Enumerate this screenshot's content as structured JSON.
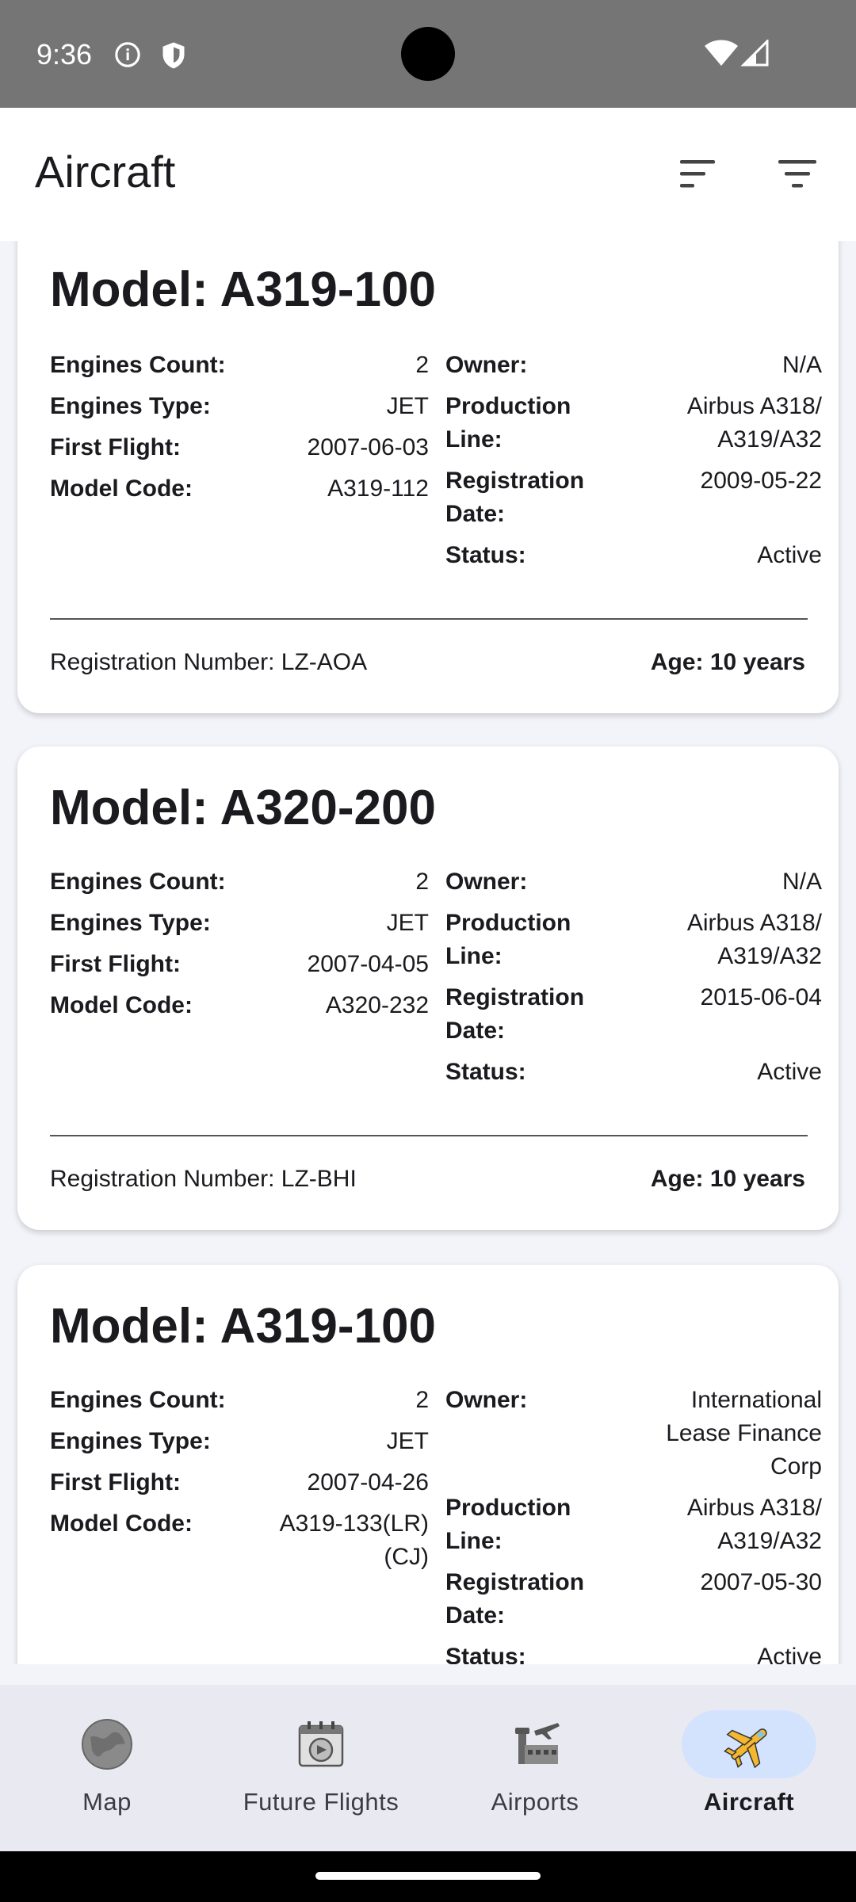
{
  "status_bar": {
    "time": "9:36"
  },
  "app_bar": {
    "title": "Aircraft"
  },
  "cards": [
    {
      "title": "Model: A319-100",
      "left": [
        {
          "label": "Engines Count:",
          "value": "2"
        },
        {
          "label": "Engines Type:",
          "value": "JET"
        },
        {
          "label": "First Flight:",
          "value": "2007-06-03"
        },
        {
          "label": "Model Code:",
          "value": "A319-112"
        }
      ],
      "right": [
        {
          "label": "Owner:",
          "value": "N/A"
        },
        {
          "label": "Production Line:",
          "value": "Airbus A318/ A319/A32"
        },
        {
          "label": "Registration Date:",
          "value": "2009-05-22"
        },
        {
          "label": "Status:",
          "value": "Active"
        }
      ],
      "registration": "Registration Number: LZ-AOA",
      "age": "Age: 10 years"
    },
    {
      "title": "Model: A320-200",
      "left": [
        {
          "label": "Engines Count:",
          "value": "2"
        },
        {
          "label": "Engines Type:",
          "value": "JET"
        },
        {
          "label": "First Flight:",
          "value": "2007-04-05"
        },
        {
          "label": "Model Code:",
          "value": "A320-232"
        }
      ],
      "right": [
        {
          "label": "Owner:",
          "value": "N/A"
        },
        {
          "label": "Production Line:",
          "value": "Airbus A318/ A319/A32"
        },
        {
          "label": "Registration Date:",
          "value": "2015-06-04"
        },
        {
          "label": "Status:",
          "value": "Active"
        }
      ],
      "registration": "Registration Number: LZ-BHI",
      "age": "Age: 10 years"
    },
    {
      "title": "Model: A319-100",
      "left": [
        {
          "label": "Engines Count:",
          "value": "2"
        },
        {
          "label": "Engines Type:",
          "value": "JET"
        },
        {
          "label": "First Flight:",
          "value": "2007-04-26"
        },
        {
          "label": "Model Code:",
          "value": "A319-133(LR) (CJ)"
        }
      ],
      "right": [
        {
          "label": "Owner:",
          "value": "International Lease Finance Corp"
        },
        {
          "label": "Production Line:",
          "value": "Airbus A318/ A319/A32"
        },
        {
          "label": "Registration Date:",
          "value": "2007-05-30"
        },
        {
          "label": "Status:",
          "value": "Active"
        }
      ]
    }
  ],
  "nav": [
    {
      "label": "Map",
      "icon": "map-icon",
      "active": false
    },
    {
      "label": "Future Flights",
      "icon": "future-flights-icon",
      "active": false
    },
    {
      "label": "Airports",
      "icon": "airports-icon",
      "active": false
    },
    {
      "label": "Aircraft",
      "icon": "aircraft-icon",
      "active": true
    }
  ],
  "colors": {
    "nav_active_pill": "#D3E3FD",
    "status_bar": "#757575"
  }
}
